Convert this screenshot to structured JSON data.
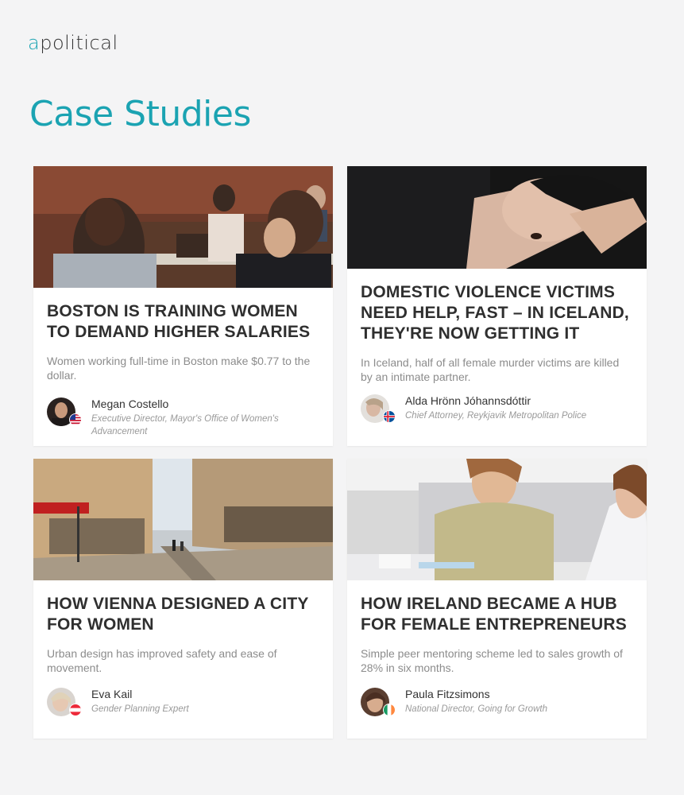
{
  "brand": {
    "logo_accent": "a",
    "logo_rest": "political",
    "accent_color": "#1ba3b2"
  },
  "page": {
    "title": "Case Studies"
  },
  "cards": [
    {
      "title": "BOSTON IS TRAINING WOMEN TO DEMAND HIGHER SALARIES",
      "summary": "Women working full-time in Boston make $0.77 to the dollar.",
      "author_name": "Megan Costello",
      "author_role": "Executive Director, Mayor's Office of Women's Advancement",
      "flag": "us-flag-icon"
    },
    {
      "title": "DOMESTIC VIOLENCE VICTIMS NEED HELP, FAST – IN ICELAND, THEY'RE NOW GETTING IT",
      "summary": "In Iceland, half of all female murder victims are killed by an intimate partner.",
      "author_name": "Alda Hrönn Jóhannsdóttir",
      "author_role": "Chief Attorney, Reykjavik Metropolitan Police",
      "flag": "iceland-flag-icon"
    },
    {
      "title": "HOW VIENNA DESIGNED A CITY FOR WOMEN",
      "summary": "Urban design has improved safety and ease of movement.",
      "author_name": "Eva Kail",
      "author_role": "Gender Planning Expert",
      "flag": "austria-flag-icon"
    },
    {
      "title": "HOW IRELAND BECAME A HUB FOR FEMALE ENTREPRENEURS",
      "summary": "Simple peer mentoring scheme led to sales growth of 28% in six months.",
      "author_name": "Paula Fitzsimons",
      "author_role": "National Director, Going for Growth",
      "flag": "ireland-flag-icon"
    }
  ]
}
